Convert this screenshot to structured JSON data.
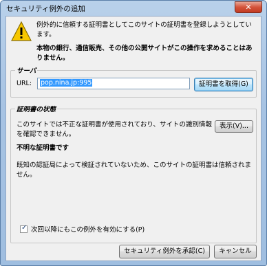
{
  "window": {
    "title": "セキュリティ例外の追加",
    "close_label": "✕"
  },
  "message": {
    "line1": "例外的に信頼する証明書としてこのサイトの証明書を登録しようとしています。",
    "line2": "本物の銀行、通信販売、その他の公開サイトがこの操作を求めることはありません。"
  },
  "server": {
    "group_label": "サーバ",
    "url_label": "URL:",
    "url_value": "pop.nina.jp:995",
    "get_cert_label": "証明書を取得(G)"
  },
  "status": {
    "group_label": "証明書の状態",
    "text": "このサイトでは不正な証明書が使用されており、サイトの識別情報を確認できません。",
    "view_label": "表示(V)...",
    "bold_text": "不明な証明書です",
    "detail": "既知の認証局によって検証されていないため、このサイトの証明書は信頼されません。"
  },
  "checkbox": {
    "label": "次回以降にもこの例外を有効にする(P)",
    "checked": true
  },
  "buttons": {
    "confirm_label": "セキュリティ例外を承認(C)",
    "cancel_label": "キャンセル"
  },
  "colors": {
    "warning": "#f6c700",
    "selection": "#3399ff"
  }
}
